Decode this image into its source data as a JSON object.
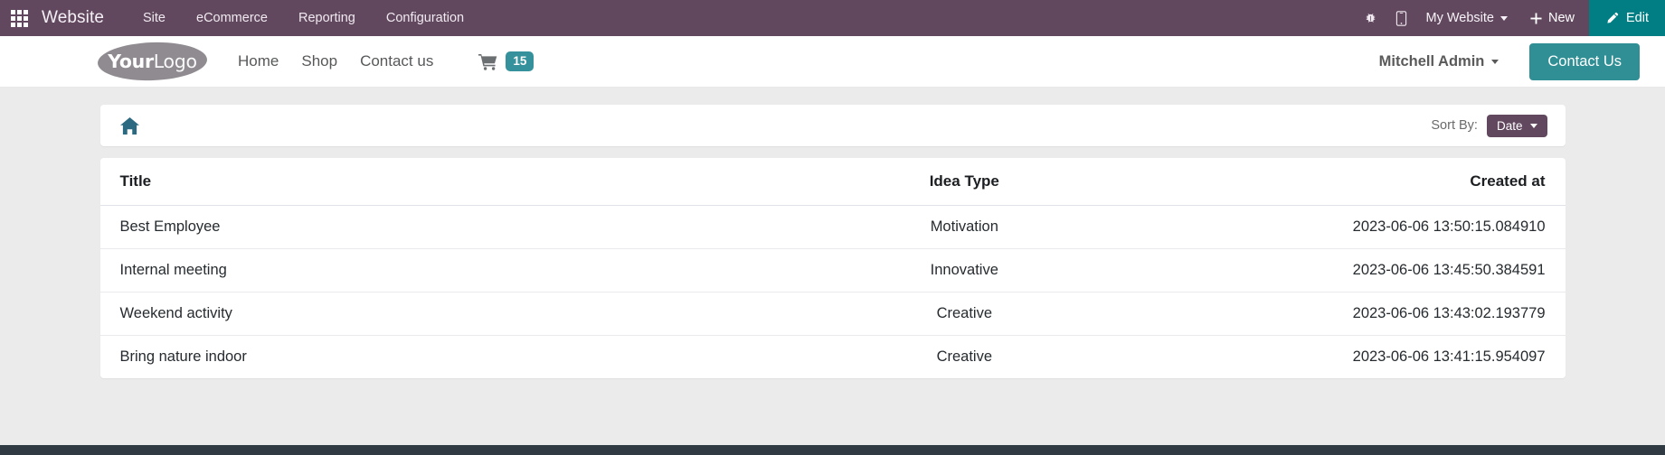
{
  "backend_navbar": {
    "apps_icon": "apps-grid-icon",
    "brand": "Website",
    "menu": [
      {
        "label": "Site"
      },
      {
        "label": "eCommerce"
      },
      {
        "label": "Reporting"
      },
      {
        "label": "Configuration"
      }
    ],
    "systray": {
      "debug_icon": "bug-icon",
      "mobile_icon": "mobile-preview-icon",
      "website_selector": "My Website",
      "new_label": "New",
      "new_icon": "plus-icon",
      "edit_label": "Edit",
      "edit_icon": "pencil-icon"
    },
    "colors": {
      "bar": "#61485f",
      "edit": "#017e84"
    }
  },
  "site_header": {
    "logo": {
      "bold": "Your",
      "light": "Logo"
    },
    "nav": [
      {
        "label": "Home"
      },
      {
        "label": "Shop"
      },
      {
        "label": "Contact us"
      }
    ],
    "cart": {
      "icon": "shopping-cart-icon",
      "count": "15",
      "badge_color": "#35919b"
    },
    "user": "Mitchell Admin",
    "cta": {
      "label": "Contact Us",
      "color": "#2f8f95"
    }
  },
  "toolbar": {
    "home_icon": "home-icon",
    "sort_label": "Sort By:",
    "sort_value": "Date",
    "sort_button_color": "#61485f"
  },
  "table": {
    "columns": [
      {
        "key": "title",
        "label": "Title"
      },
      {
        "key": "idea_type",
        "label": "Idea Type"
      },
      {
        "key": "created_at",
        "label": "Created at"
      }
    ],
    "rows": [
      {
        "title": "Best Employee",
        "idea_type": "Motivation",
        "created_at": "2023-06-06 13:50:15.084910"
      },
      {
        "title": "Internal meeting",
        "idea_type": "Innovative",
        "created_at": "2023-06-06 13:45:50.384591"
      },
      {
        "title": "Weekend activity",
        "idea_type": "Creative",
        "created_at": "2023-06-06 13:43:02.193779"
      },
      {
        "title": "Bring nature indoor",
        "idea_type": "Creative",
        "created_at": "2023-06-06 13:41:15.954097"
      }
    ]
  },
  "footer": {
    "color": "#2f3a42"
  }
}
